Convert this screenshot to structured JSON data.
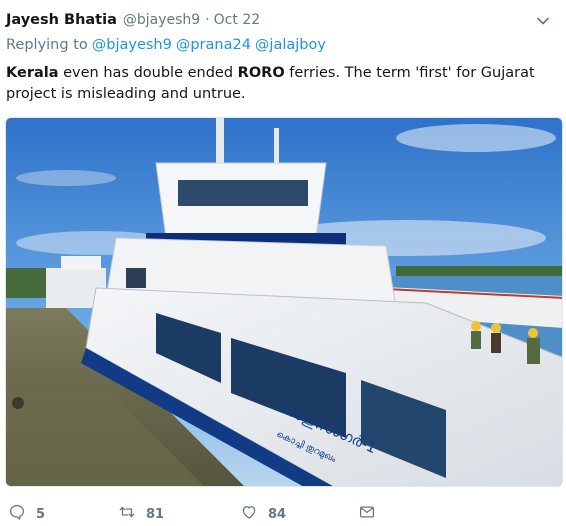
{
  "tweet": {
    "author": {
      "display_name": "Jayesh Bhatia",
      "handle": "@bjayesh9"
    },
    "separator": "·",
    "date": "Oct 22",
    "replying_to_label": "Replying to",
    "replying_to": [
      "@bjayesh9",
      "@prana24",
      "@jalajboy"
    ],
    "text_parts": {
      "kerala": "Kerala",
      "part1": " even has double ended ",
      "roro": "RORO",
      "part2": " ferries. The term 'first' for Gujarat project is misleading and untrue."
    },
    "media": {
      "hull_text": "സേതുസാഗർ-1",
      "hull_text_sub": "കൊച്ചി തുറമുഖം"
    },
    "actions": {
      "replies": "5",
      "retweets": "81",
      "likes": "84"
    }
  },
  "colors": {
    "link": "#1b95e0",
    "secondary": "#657786",
    "primary_text": "#14171a"
  },
  "icons": [
    "chevron-down-icon",
    "reply-icon",
    "retweet-icon",
    "like-icon",
    "direct-message-icon"
  ]
}
